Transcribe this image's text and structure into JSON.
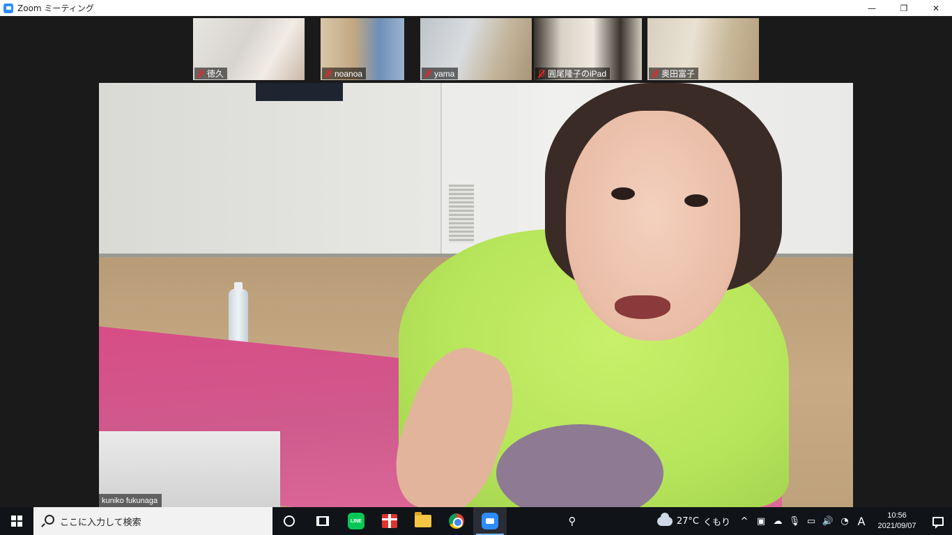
{
  "window": {
    "title": "Zoom ミーティング",
    "minimize": "—",
    "restore": "❐",
    "close": "✕"
  },
  "participants": [
    {
      "name": "徳久",
      "muted": true
    },
    {
      "name": "noanoa",
      "muted": true
    },
    {
      "name": "yama",
      "muted": true
    },
    {
      "name": "圓尾隆子のiPad",
      "muted": true
    },
    {
      "name": "奥田富子",
      "muted": true
    }
  ],
  "active_speaker": {
    "name": "kuniko fukunaga"
  },
  "taskbar": {
    "search_placeholder": "ここに入力して検索",
    "line_label": "LINE",
    "weather": {
      "temp": "27°C",
      "condition": "くもり"
    },
    "tray_chevron": "^",
    "ime": "A",
    "clock": {
      "time": "10:56",
      "date": "2021/09/07"
    }
  }
}
